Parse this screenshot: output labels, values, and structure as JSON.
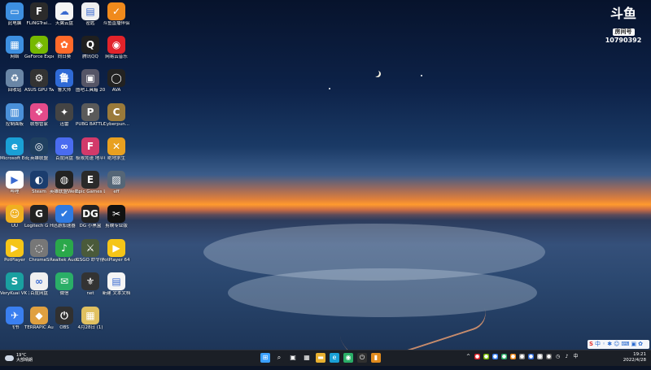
{
  "desktop": {
    "icons": [
      {
        "label": "此电脑",
        "color": "#3d8fe0",
        "glyph": "▭",
        "icon": "computer-icon"
      },
      {
        "label": "FLiNGTrai...",
        "color": "#2b2b2b",
        "glyph": "F",
        "icon": "fling-trainer-icon"
      },
      {
        "label": "天翼云盘",
        "color": "#f5f5f5",
        "glyph": "☁",
        "icon": "cloud-drive-icon"
      },
      {
        "label": "密匙",
        "color": "#f0f0f0",
        "glyph": "▤",
        "icon": "text-file-icon"
      },
      {
        "label": "斗鱼直播伴侣",
        "color": "#f08a1c",
        "glyph": "✓",
        "icon": "douyu-assistant-icon"
      },
      {
        "label": "网络",
        "color": "#3d8fe0",
        "glyph": "▦",
        "icon": "network-icon"
      },
      {
        "label": "GeForce Experience",
        "color": "#76b900",
        "glyph": "◈",
        "icon": "geforce-icon"
      },
      {
        "label": "向日葵",
        "color": "#ff6a2a",
        "glyph": "✿",
        "icon": "sunflower-icon"
      },
      {
        "label": "腾讯QQ",
        "color": "#1f1f1f",
        "glyph": "Q",
        "icon": "qq-icon"
      },
      {
        "label": "网易云音乐",
        "color": "#e2232a",
        "glyph": "◉",
        "icon": "netease-music-icon"
      },
      {
        "label": "回收站",
        "color": "#6a86a6",
        "glyph": "♻",
        "icon": "recycle-bin-icon"
      },
      {
        "label": "ASUS GPU Tweakll",
        "color": "#333",
        "glyph": "⚙",
        "icon": "asus-gpu-icon"
      },
      {
        "label": "鲁大师",
        "color": "#2f6ad6",
        "glyph": "鲁",
        "icon": "ludashi-icon"
      },
      {
        "label": "图吧工具箱 2022",
        "color": "#556",
        "glyph": "▣",
        "icon": "toolbox-icon"
      },
      {
        "label": "AVA",
        "color": "#222",
        "glyph": "◯",
        "icon": "ava-icon"
      },
      {
        "label": "控制面板",
        "color": "#4a90d9",
        "glyph": "▥",
        "icon": "control-panel-icon"
      },
      {
        "label": "联想管家",
        "color": "#e44b8a",
        "glyph": "❖",
        "icon": "lenovo-icon"
      },
      {
        "label": "迅雷",
        "color": "#444",
        "glyph": "✦",
        "icon": "xunlei-icon"
      },
      {
        "label": "PUBG BATTLEGR...",
        "color": "#5a5a5a",
        "glyph": "P",
        "icon": "pubg-icon"
      },
      {
        "label": "Cyberpun...",
        "color": "#9a7a3a",
        "glyph": "C",
        "icon": "cyberpunk-icon"
      },
      {
        "label": "Microsoft Edge",
        "color": "#1aa0d6",
        "glyph": "e",
        "icon": "edge-icon"
      },
      {
        "label": "英雄联盟",
        "color": "#204060",
        "glyph": "◎",
        "icon": "lol-icon"
      },
      {
        "label": "百度网盘",
        "color": "#4a6cf0",
        "glyph": "∞",
        "icon": "baidu-netdisk-icon"
      },
      {
        "label": "极限竞速 地平线5",
        "color": "#d23a6a",
        "glyph": "F",
        "icon": "forza-icon"
      },
      {
        "label": "绝地求生",
        "color": "#e8a020",
        "glyph": "✕",
        "icon": "game-x-icon"
      },
      {
        "label": "哔哩",
        "color": "#fff",
        "glyph": "▶",
        "icon": "bilibili-icon"
      },
      {
        "label": "Steam",
        "color": "#1b3d6e",
        "glyph": "◐",
        "icon": "steam-icon"
      },
      {
        "label": "英雄联盟WeGame",
        "color": "#222",
        "glyph": "◍",
        "icon": "wegame-icon"
      },
      {
        "label": "Epic Games Launcher",
        "color": "#2a2a2a",
        "glyph": "E",
        "icon": "epic-icon"
      },
      {
        "label": "eff",
        "color": "#556677",
        "glyph": "▨",
        "icon": "game-image-icon"
      },
      {
        "label": "UU",
        "color": "#f0b020",
        "glyph": "☺",
        "icon": "uu-booster-icon"
      },
      {
        "label": "Logitech G HUB",
        "color": "#222",
        "glyph": "G",
        "icon": "logitech-icon"
      },
      {
        "label": "迅游加速器",
        "color": "#2f7ae0",
        "glyph": "✔",
        "icon": "booster-icon"
      },
      {
        "label": "DG 小黑盒",
        "color": "#222",
        "glyph": "DG",
        "icon": "dg-icon"
      },
      {
        "label": "剪映专业版",
        "color": "#111",
        "glyph": "✂",
        "icon": "capcut-icon"
      },
      {
        "label": "PotPlayer",
        "color": "#f5c518",
        "glyph": "▶",
        "icon": "potplayer-icon"
      },
      {
        "label": "ChromeS",
        "color": "#777",
        "glyph": "◌",
        "icon": "chrome-icon"
      },
      {
        "label": "Realtek Audio",
        "color": "#2aa84a",
        "glyph": "♪",
        "icon": "realtek-icon"
      },
      {
        "label": "CSGO 命令行",
        "color": "#4a5a3a",
        "glyph": "⚔",
        "icon": "csgo-icon"
      },
      {
        "label": "PotPlayer 64 bit",
        "color": "#f5c518",
        "glyph": "▶",
        "icon": "potplayer64-icon"
      },
      {
        "label": "VeryKuai VK 加速器",
        "color": "#1aa0a0",
        "glyph": "S",
        "icon": "verykuai-icon"
      },
      {
        "label": "百度网盘",
        "color": "#f0f0f0",
        "glyph": "∞",
        "icon": "baidu-pan-icon"
      },
      {
        "label": "微信",
        "color": "#2aae67",
        "glyph": "✉",
        "icon": "wechat-icon"
      },
      {
        "label": "net",
        "color": "#333",
        "glyph": "⚜",
        "icon": "net-icon"
      },
      {
        "label": "新建 文本文档",
        "color": "#f5f5f5",
        "glyph": "▤",
        "icon": "new-text-doc-icon"
      },
      {
        "label": "飞书",
        "color": "#3a7ff0",
        "glyph": "✈",
        "icon": "feishu-icon"
      },
      {
        "label": "TERRAPIC Audio C...",
        "color": "#e0a040",
        "glyph": "◆",
        "icon": "terrapic-icon"
      },
      {
        "label": "OBS",
        "color": "#303030",
        "glyph": "⏻",
        "icon": "obs-icon"
      },
      {
        "label": "4月28日 (1)",
        "color": "#e0c060",
        "glyph": "▦",
        "icon": "folder-icon"
      }
    ]
  },
  "watermark": {
    "mark": "斗鱼",
    "room_label": "房间号",
    "room_number": "10790392"
  },
  "ime": {
    "items": [
      "中",
      "◦",
      "✱",
      "☺",
      "⌨",
      "▣",
      "✿"
    ]
  },
  "taskbar": {
    "weather_temp": "19°C",
    "weather_desc": "大部晴朗",
    "time": "19:21",
    "date": "2022/4/28",
    "center_icons": [
      {
        "glyph": "⊞",
        "color": "#3aa0ff",
        "icon": "start-icon"
      },
      {
        "glyph": "⌕",
        "color": "#1b1f26",
        "icon": "search-icon"
      },
      {
        "glyph": "▣",
        "color": "#1b1f26",
        "icon": "task-view-icon"
      },
      {
        "glyph": "▦",
        "color": "#1b1f26",
        "icon": "widgets-icon"
      },
      {
        "glyph": "▬",
        "color": "#e8b030",
        "icon": "file-explorer-icon"
      },
      {
        "glyph": "e",
        "color": "#1aa0d6",
        "icon": "edge-taskbar-icon"
      },
      {
        "glyph": "◉",
        "color": "#2aae67",
        "icon": "app-taskbar-icon-1"
      },
      {
        "glyph": "⏻",
        "color": "#303030",
        "icon": "obs-taskbar-icon"
      },
      {
        "glyph": "▮",
        "color": "#e08a1c",
        "icon": "douyu-taskbar-icon"
      }
    ],
    "tray_icons": [
      {
        "glyph": "^",
        "color": "#1b1f26",
        "icon": "chevron-up-icon"
      },
      {
        "glyph": "●",
        "color": "#e2232a",
        "icon": "tray-icon-1"
      },
      {
        "glyph": "●",
        "color": "#76b900",
        "icon": "tray-icon-2"
      },
      {
        "glyph": "●",
        "color": "#3a7ff0",
        "icon": "tray-icon-3"
      },
      {
        "glyph": "●",
        "color": "#2aae67",
        "icon": "tray-icon-4"
      },
      {
        "glyph": "●",
        "color": "#f08a1c",
        "icon": "tray-icon-5"
      },
      {
        "glyph": "●",
        "color": "#888",
        "icon": "tray-icon-6"
      },
      {
        "glyph": "●",
        "color": "#2f6ad6",
        "icon": "tray-icon-7"
      },
      {
        "glyph": "●",
        "color": "#aaa",
        "icon": "tray-icon-8"
      },
      {
        "glyph": "●",
        "color": "#666",
        "icon": "tray-icon-9"
      },
      {
        "glyph": "◷",
        "color": "#1b1f26",
        "icon": "wifi-icon"
      },
      {
        "glyph": "♪",
        "color": "#1b1f26",
        "icon": "volume-icon"
      },
      {
        "glyph": "中",
        "color": "#1b1f26",
        "icon": "ime-icon"
      }
    ]
  }
}
